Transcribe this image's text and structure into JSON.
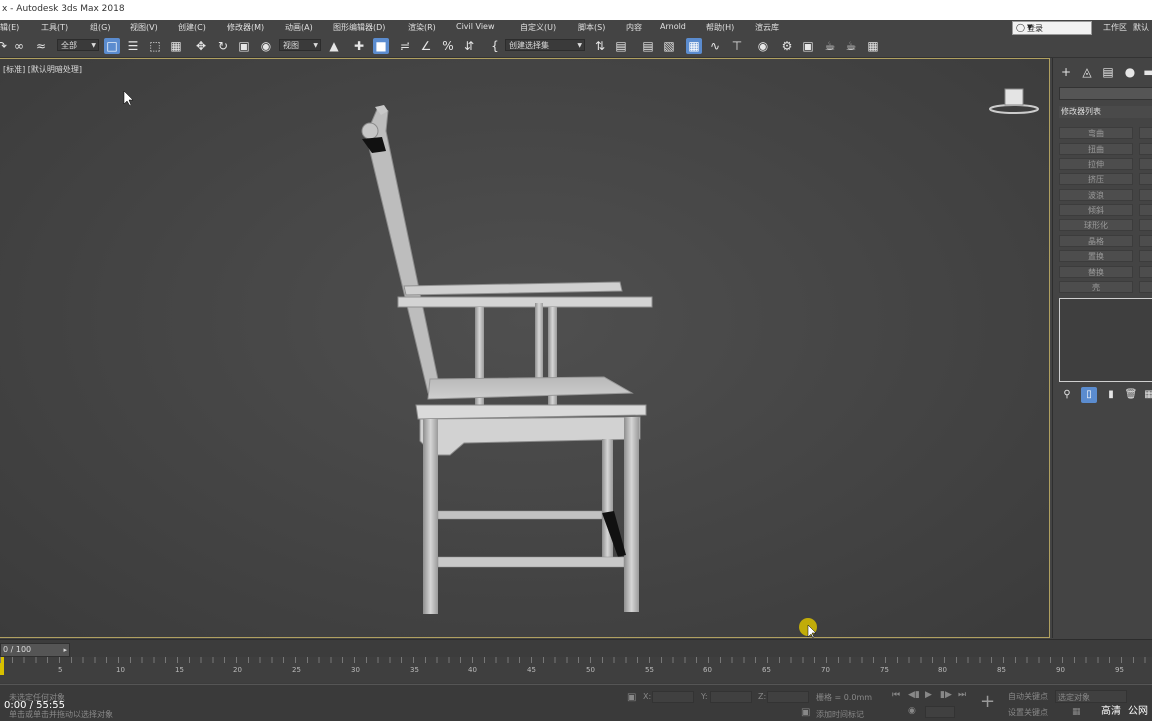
{
  "window": {
    "title": "x - Autodesk 3ds Max 2018"
  },
  "menu": {
    "items": [
      "辑(E)",
      "工具(T)",
      "组(G)",
      "视图(V)",
      "创建(C)",
      "修改器(M)",
      "动画(A)",
      "图形编辑器(D)",
      "渲染(R)",
      "Civil View",
      "自定义(U)",
      "脚本(S)",
      "内容",
      "Arnold",
      "帮助(H)",
      "渲云库"
    ],
    "login": "登录",
    "workspace": "工作区",
    "default": "默认"
  },
  "toolbar": {
    "filter": "全部",
    "ref_coord": "视图",
    "selection_set": "创建选择集"
  },
  "viewport": {
    "label": "[标准] [默认明暗处理]"
  },
  "command_panel": {
    "modifier_list": "修改器列表",
    "buttons": [
      "弯曲",
      "扭曲",
      "拉伸",
      "挤压",
      "波浪",
      "倾斜",
      "球形化",
      "晶格",
      "置换",
      "替换",
      "壳"
    ]
  },
  "timeline": {
    "slider": "0 / 100",
    "ticks": [
      "5",
      "10",
      "15",
      "20",
      "25",
      "30",
      "35",
      "40",
      "45",
      "50",
      "55",
      "60",
      "65",
      "70",
      "75",
      "80",
      "85",
      "90",
      "95"
    ]
  },
  "status": {
    "line1": "未选定任何对象",
    "line2": "单击或单击并拖动以选择对象",
    "x_label": "X:",
    "y_label": "Y:",
    "z_label": "Z:",
    "grid": "栅格 = 0.0mm",
    "add_time_tag": "添加时间标记",
    "auto_key": "自动关键点",
    "set_key": "设置关键点",
    "selected_object": "选定对象"
  },
  "video_overlay": {
    "time": "0:00 / 55:55",
    "quality": "高清",
    "extra": "公网"
  },
  "colors": {
    "viewport_border": "#b0a060",
    "active_button": "#5b8ccf",
    "time_marker": "#d8c000"
  }
}
